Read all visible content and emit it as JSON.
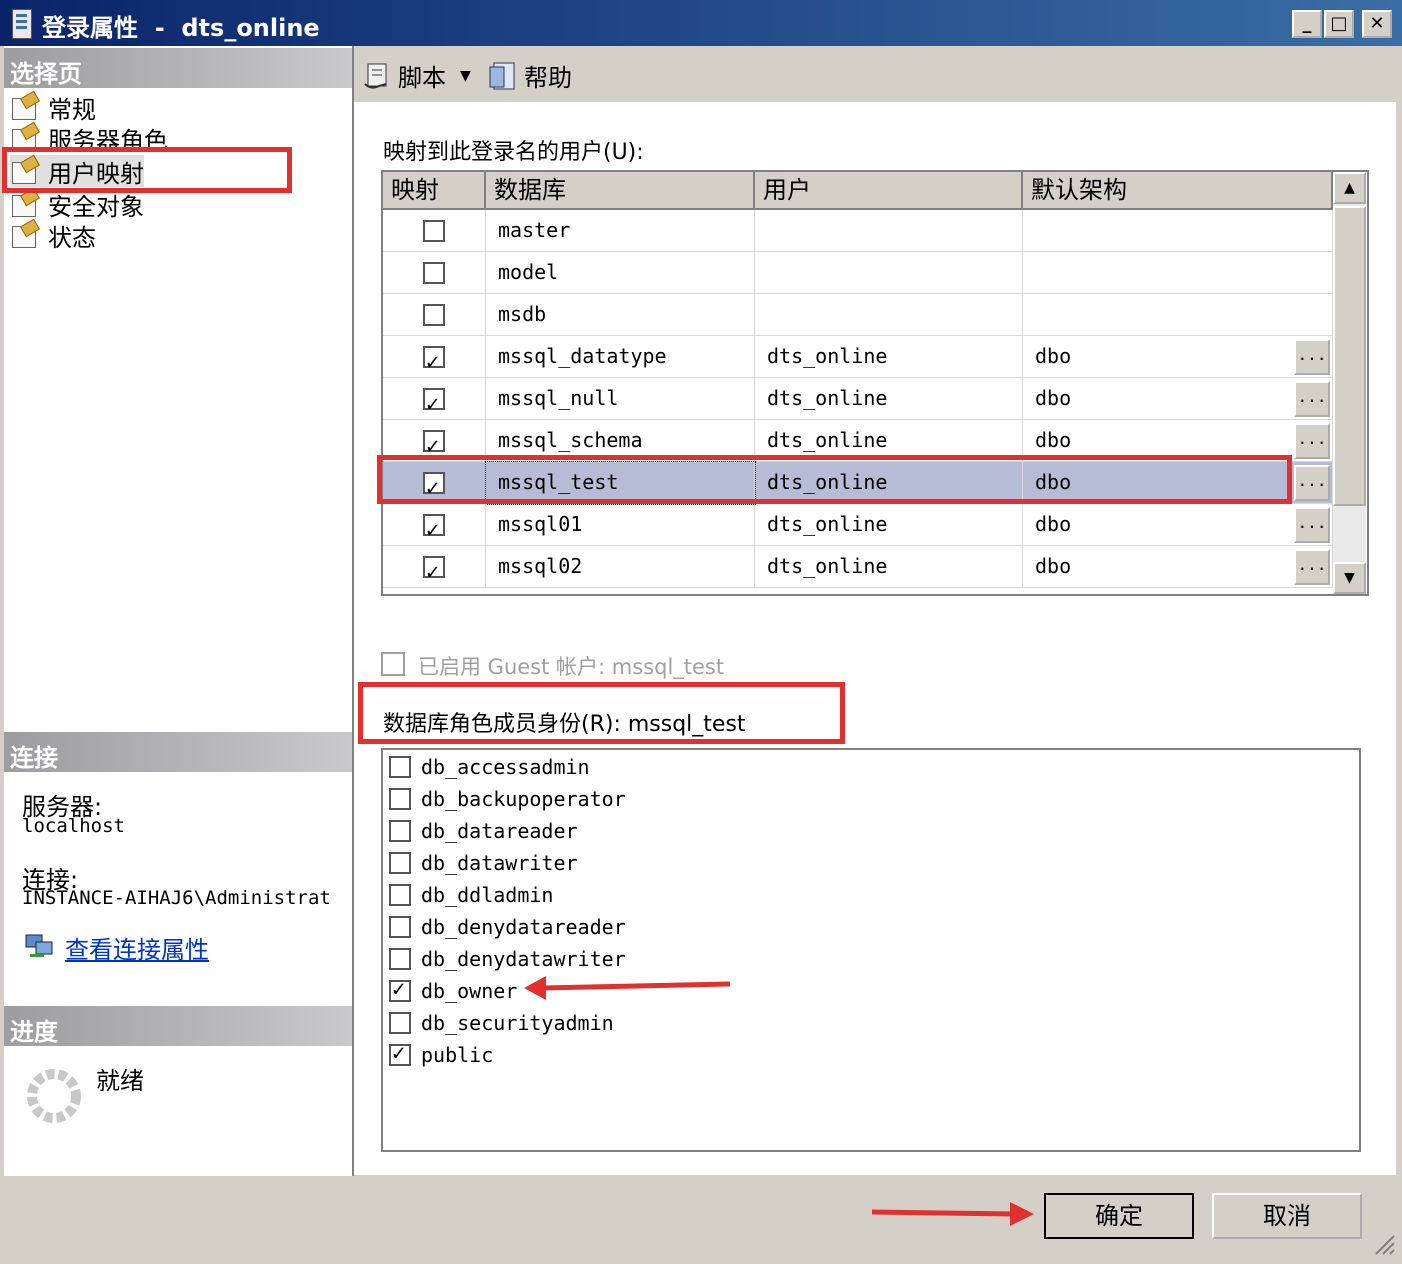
{
  "window": {
    "title": "登录属性  -  dts_online",
    "controls": {
      "minimize": "_",
      "maximize": "□",
      "close": "✕"
    }
  },
  "left": {
    "select_page_header": "选择页",
    "pages": [
      {
        "label": "常规",
        "icon": "page-icon"
      },
      {
        "label": "服务器角色",
        "icon": "page-icon"
      },
      {
        "label": "用户映射",
        "icon": "page-icon",
        "selected": true
      },
      {
        "label": "安全对象",
        "icon": "page-icon"
      },
      {
        "label": "状态",
        "icon": "page-icon"
      }
    ],
    "connection_header": "连接",
    "server_label": "服务器:",
    "server_value": "localhost",
    "connection_label": "连接:",
    "connection_value": "INSTANCE-AIHAJ6\\Administrat",
    "view_connection_link": "查看连接属性",
    "progress_header": "进度",
    "progress_status": "就绪"
  },
  "toolbar": {
    "script_label": "脚本",
    "help_label": "帮助"
  },
  "mapping": {
    "label": "映射到此登录名的用户(U):",
    "columns": [
      "映射",
      "数据库",
      "用户",
      "默认架构"
    ],
    "rows": [
      {
        "mapped": false,
        "database": "master",
        "user": "",
        "schema": ""
      },
      {
        "mapped": false,
        "database": "model",
        "user": "",
        "schema": ""
      },
      {
        "mapped": false,
        "database": "msdb",
        "user": "",
        "schema": ""
      },
      {
        "mapped": true,
        "database": "mssql_datatype",
        "user": "dts_online",
        "schema": "dbo"
      },
      {
        "mapped": true,
        "database": "mssql_null",
        "user": "dts_online",
        "schema": "dbo"
      },
      {
        "mapped": true,
        "database": "mssql_schema",
        "user": "dts_online",
        "schema": "dbo"
      },
      {
        "mapped": true,
        "database": "mssql_test",
        "user": "dts_online",
        "schema": "dbo",
        "selected": true
      },
      {
        "mapped": true,
        "database": "mssql01",
        "user": "dts_online",
        "schema": "dbo"
      },
      {
        "mapped": true,
        "database": "mssql02",
        "user": "dts_online",
        "schema": "dbo"
      }
    ],
    "ellipsis": "..."
  },
  "guest": {
    "label": "已启用 Guest 帐户: mssql_test",
    "checked": false
  },
  "roles": {
    "label": "数据库角色成员身份(R): mssql_test",
    "items": [
      {
        "name": "db_accessadmin",
        "checked": false
      },
      {
        "name": "db_backupoperator",
        "checked": false
      },
      {
        "name": "db_datareader",
        "checked": false
      },
      {
        "name": "db_datawriter",
        "checked": false
      },
      {
        "name": "db_ddladmin",
        "checked": false
      },
      {
        "name": "db_denydatareader",
        "checked": false
      },
      {
        "name": "db_denydatawriter",
        "checked": false
      },
      {
        "name": "db_owner",
        "checked": true
      },
      {
        "name": "db_securityadmin",
        "checked": false
      },
      {
        "name": "public",
        "checked": true
      }
    ]
  },
  "buttons": {
    "ok": "确定",
    "cancel": "取消"
  },
  "colors": {
    "highlight": "#e03030",
    "selected_row": "#b6bcd6",
    "title_bar": "#0a246a"
  }
}
